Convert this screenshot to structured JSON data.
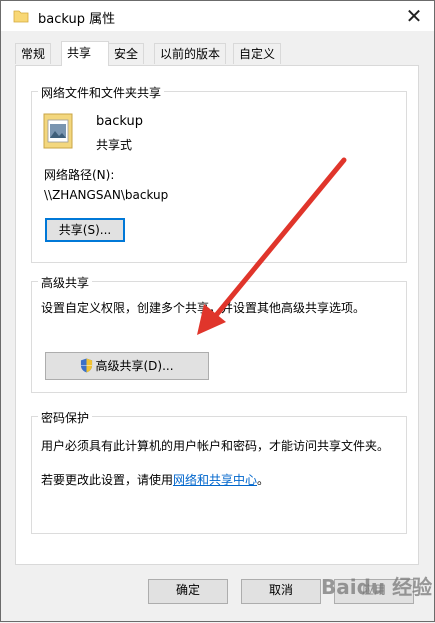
{
  "window": {
    "title": "backup 属性",
    "close_glyph": "✕"
  },
  "tabs": [
    {
      "label": "常规",
      "active": false
    },
    {
      "label": "共享",
      "active": true
    },
    {
      "label": "安全",
      "active": false
    },
    {
      "label": "以前的版本",
      "active": false
    },
    {
      "label": "自定义",
      "active": false
    }
  ],
  "network_sharing": {
    "group_title": "网络文件和文件夹共享",
    "folder_name": "backup",
    "folder_status": "共享式",
    "path_label": "网络路径(N):",
    "path_value": "\\\\ZHANGSAN\\backup",
    "share_button": "共享(S)..."
  },
  "advanced_sharing": {
    "group_title": "高级共享",
    "description": "设置自定义权限，创建多个共享，并设置其他高级共享选项。",
    "button_label": "高级共享(D)..."
  },
  "password_protection": {
    "group_title": "密码保护",
    "description": "用户必须具有此计算机的用户帐户和密码，才能访问共享文件夹。",
    "change_prefix": "若要更改此设置，请使用",
    "link_text": "网络和共享中心",
    "change_suffix": "。"
  },
  "footer": {
    "ok": "确定",
    "cancel": "取消",
    "apply_partial": "应用"
  },
  "watermark": "Baidu 经验",
  "colors": {
    "accent": "#0078d7",
    "arrow": "#e0352b",
    "link": "#0066cc"
  },
  "icons": {
    "folder": "folder-icon",
    "shield": "uac-shield-icon",
    "close": "close-icon"
  }
}
